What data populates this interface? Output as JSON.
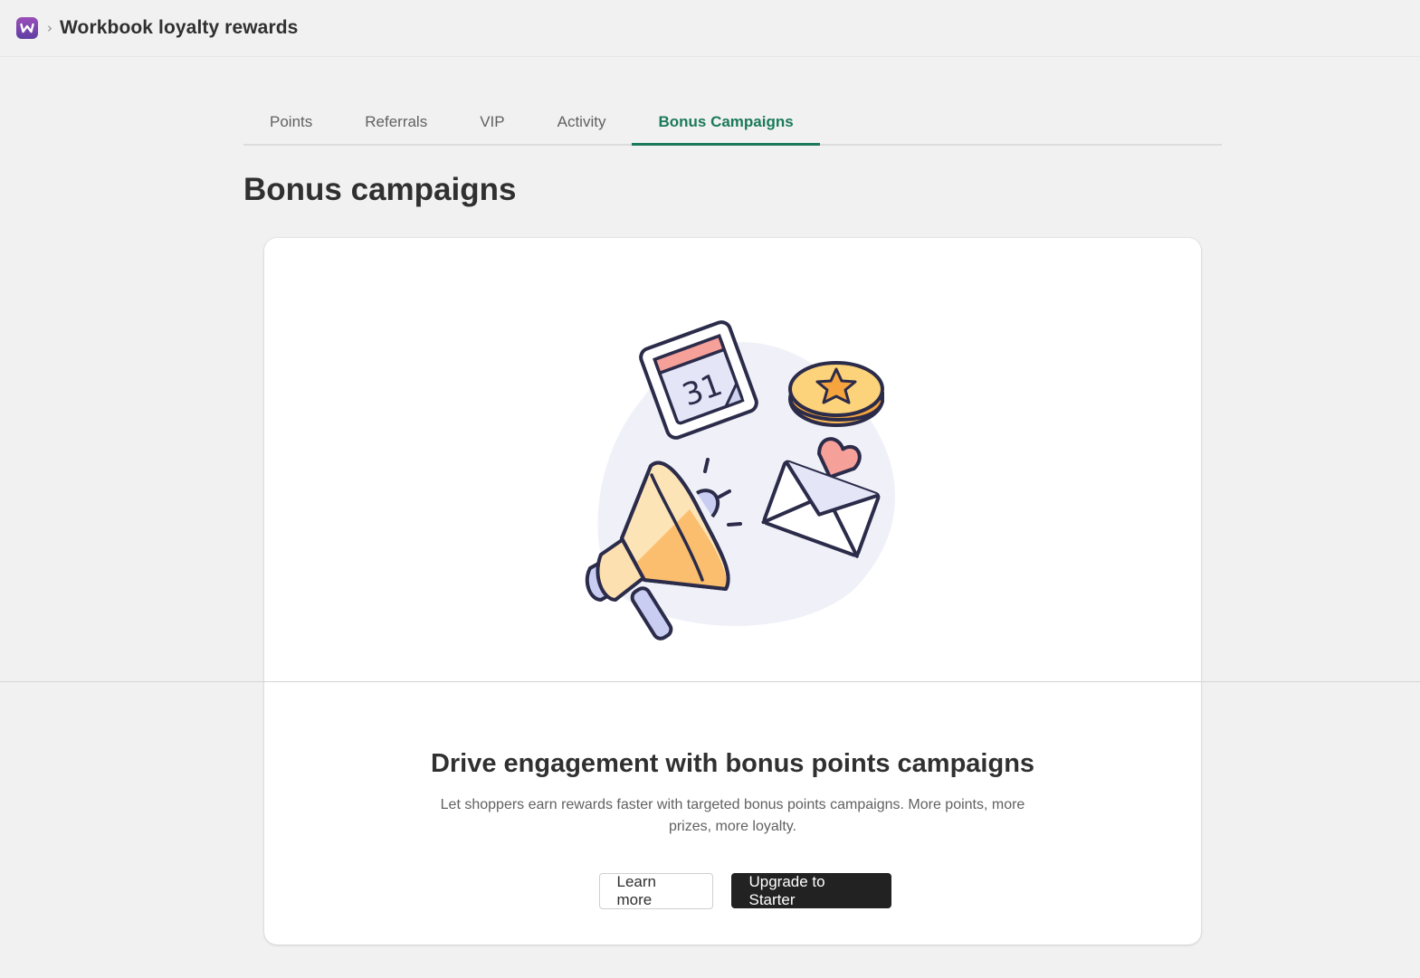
{
  "header": {
    "app_icon": "workbook-logo-icon",
    "separator": "›",
    "title": "Workbook loyalty rewards"
  },
  "tabs": [
    {
      "label": "Points",
      "active": false
    },
    {
      "label": "Referrals",
      "active": false
    },
    {
      "label": "VIP",
      "active": false
    },
    {
      "label": "Activity",
      "active": false
    },
    {
      "label": "Bonus Campaigns",
      "active": true
    }
  ],
  "page": {
    "title": "Bonus campaigns"
  },
  "card": {
    "illustration": {
      "calendar_day": "31",
      "icons": [
        "calendar-icon",
        "coin-star-icon",
        "megaphone-icon",
        "envelope-heart-icon"
      ]
    },
    "title": "Drive engagement with bonus points campaigns",
    "description": "Let shoppers earn rewards faster with targeted bonus points campaigns. More points, more prizes, more loyalty.",
    "learn_more_label": "Learn more",
    "upgrade_label": "Upgrade to Starter"
  },
  "colors": {
    "accent": "#1b7a5a",
    "primary_button": "#222222",
    "background": "#f1f1f1",
    "card": "#ffffff"
  }
}
